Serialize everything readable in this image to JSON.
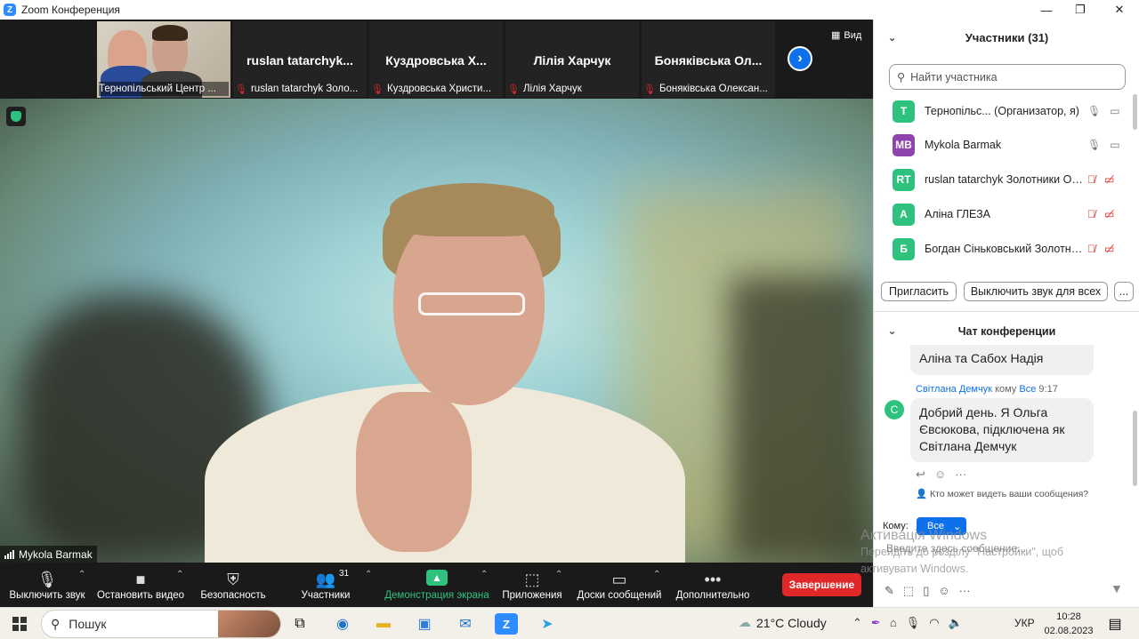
{
  "window": {
    "title": "Zoom Конференция",
    "logo": "Z",
    "minimize": "—",
    "maximize": "❐",
    "close": "✕"
  },
  "strip": {
    "tiles": [
      {
        "name": "",
        "caption": "Тернопільський Центр ..."
      },
      {
        "name": "ruslan  tatarchyk...",
        "caption": "ruslan tatarchyk Золо..."
      },
      {
        "name": "Куздровська  Х...",
        "caption": "Куздровська Христи..."
      },
      {
        "name": "Лілія Харчук",
        "caption": "Лілія Харчук"
      },
      {
        "name": "Боняківська  Ол...",
        "caption": "Боняківська Олексан..."
      }
    ],
    "view_label": "Вид"
  },
  "main_video": {
    "speaker_label": "Mykola Barmak"
  },
  "toolbar": {
    "mute": "Выключить звук",
    "video": "Остановить видео",
    "security": "Безопасность",
    "participants": "Участники",
    "participants_count": "31",
    "share": "Демонстрация экрана",
    "apps": "Приложения",
    "whiteboards": "Доски сообщений",
    "more": "Дополнительно",
    "end": "Завершение"
  },
  "participants_panel": {
    "title": "Участники (31)",
    "search_placeholder": "Найти участника",
    "rows": [
      {
        "initials": "T",
        "color": "#2ec27e",
        "name": "Тернопільс...  (Организатор, я)",
        "muted": false
      },
      {
        "initials": "MB",
        "color": "#8e44ad",
        "name": "Mykola Barmak",
        "muted": false
      },
      {
        "initials": "RT",
        "color": "#2ec27e",
        "name": "ruslan tatarchyk Золотники Ос...",
        "muted": true
      },
      {
        "initials": "A",
        "color": "#2ec27e",
        "name": "Аліна ГЛЕЗА",
        "muted": true
      },
      {
        "initials": "Б",
        "color": "#2ec27e",
        "name": "Богдан Сіньковський Золотни...",
        "muted": true
      }
    ],
    "invite": "Пригласить",
    "mute_all": "Выключить звук для всех",
    "more": "..."
  },
  "chat": {
    "title": "Чат конференции",
    "prev_message": "Аліна та Сабох Надія",
    "sender": "Світлана Демчук",
    "to_word": "кому",
    "to_target": "Все",
    "time": "9:17",
    "avatar": "С",
    "message_lines": [
      "Добрий день. Я Ольга",
      "Євсюкова, підключена як",
      "Світлана Демчук"
    ],
    "who_can_see": "Кто может видеть ваши сообщения?",
    "to_label": "Кому:",
    "to_value": "Все",
    "input_placeholder": "Введите здесь сообщение..."
  },
  "watermark": {
    "title": "Активація Windows",
    "line1": "Перейдіть до розділу \"Настройки\", щоб",
    "line2": "активувати Windows."
  },
  "taskbar": {
    "search": "Пошук",
    "weather": "21°C  Cloudy",
    "lang": "УКР",
    "time": "10:28",
    "date": "02.08.2023"
  }
}
